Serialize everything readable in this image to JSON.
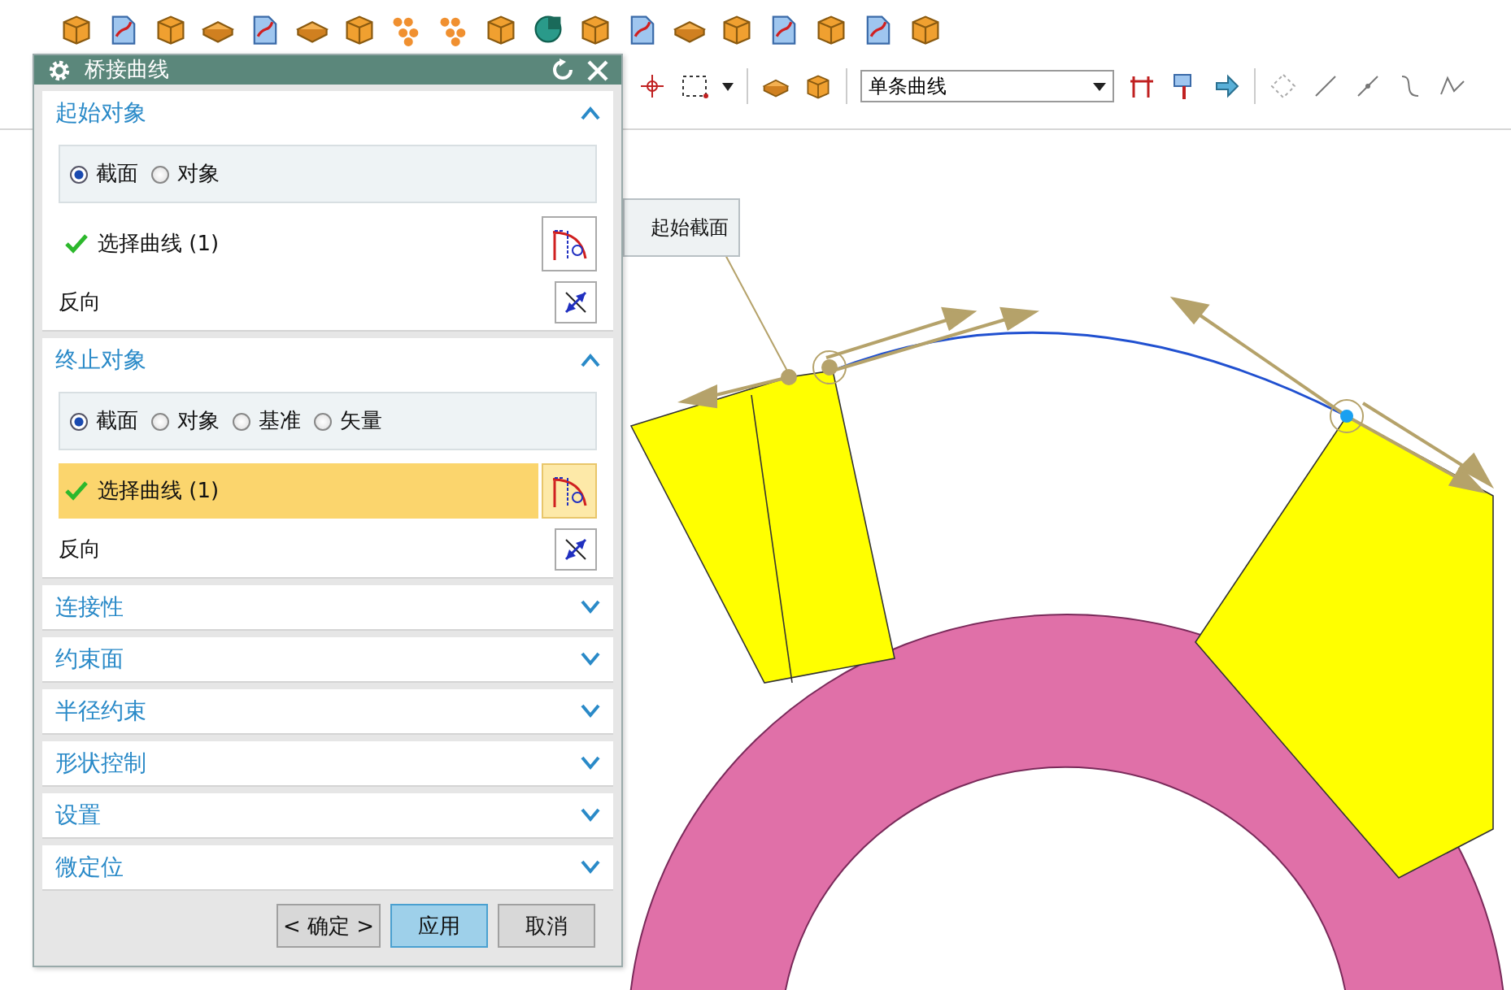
{
  "toolbar": {
    "curve_rule": "单条曲线"
  },
  "viewport": {
    "section_label": "起始截面"
  },
  "dialog": {
    "title": "桥接曲线",
    "sections": [
      {
        "title": "起始对象",
        "expanded": true,
        "options": [
          {
            "label": "截面",
            "selected": true
          },
          {
            "label": "对象",
            "selected": false
          }
        ],
        "select": {
          "label": "选择曲线 (1)",
          "active": false
        },
        "reverse_label": "反向"
      },
      {
        "title": "终止对象",
        "expanded": true,
        "options": [
          {
            "label": "截面",
            "selected": true
          },
          {
            "label": "对象",
            "selected": false
          },
          {
            "label": "基准",
            "selected": false
          },
          {
            "label": "矢量",
            "selected": false
          }
        ],
        "select": {
          "label": "选择曲线 (1)",
          "active": true
        },
        "reverse_label": "反向"
      },
      {
        "title": "连接性",
        "expanded": false
      },
      {
        "title": "约束面",
        "expanded": false
      },
      {
        "title": "半径约束",
        "expanded": false
      },
      {
        "title": "形状控制",
        "expanded": false
      },
      {
        "title": "设置",
        "expanded": false
      },
      {
        "title": "微定位",
        "expanded": false
      }
    ],
    "buttons": [
      {
        "label": "< 确定 >",
        "kind": "ok"
      },
      {
        "label": "应用",
        "kind": "default"
      },
      {
        "label": "取消",
        "kind": "cancel"
      }
    ]
  }
}
